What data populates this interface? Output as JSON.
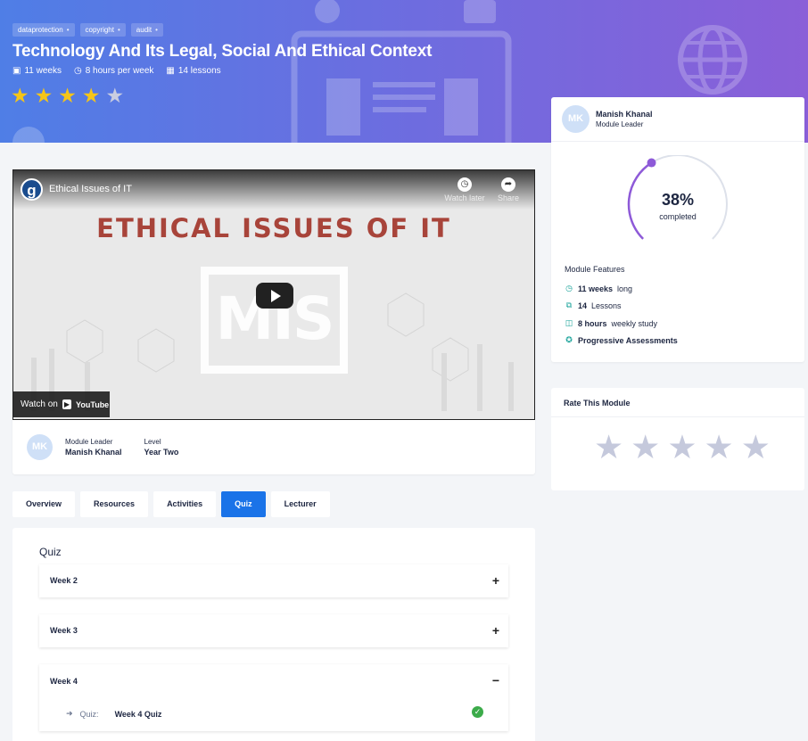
{
  "hero": {
    "tags": [
      "dataprotection",
      "copyright",
      "audit"
    ],
    "title": "Technology And Its Legal, Social And Ethical Context",
    "meta": {
      "weeks": "11 weeks",
      "hours": "8 hours per week",
      "lessons": "14 lessons"
    },
    "rating": {
      "value": 4,
      "max": 5
    }
  },
  "video": {
    "channel_initial": "g",
    "title": "Ethical Issues of IT",
    "watch_later": "Watch later",
    "share": "Share",
    "banner": "ETHICAL ISSUES OF IT",
    "logo_text": "MIS",
    "watch_on": "Watch on",
    "youtube": "YouTube"
  },
  "leader_row": {
    "initials": "MK",
    "leader_label": "Module Leader",
    "leader_name": "Manish Khanal",
    "level_label": "Level",
    "level_value": "Year Two"
  },
  "tabs": [
    {
      "label": "Overview",
      "active": false
    },
    {
      "label": "Resources",
      "active": false
    },
    {
      "label": "Activities",
      "active": false
    },
    {
      "label": "Quiz",
      "active": true
    },
    {
      "label": "Lecturer",
      "active": false
    }
  ],
  "quiz": {
    "heading": "Quiz",
    "weeks": [
      {
        "label": "Week 2",
        "open": false
      },
      {
        "label": "Week 3",
        "open": false
      },
      {
        "label": "Week 4",
        "open": true
      }
    ],
    "item": {
      "kind": "Quiz:",
      "name": "Week 4 Quiz",
      "done": true
    }
  },
  "sidebar": {
    "initials": "MK",
    "name": "Manish Khanal",
    "role": "Module Leader",
    "progress": {
      "percent": 38,
      "percent_label": "38%",
      "caption": "completed"
    },
    "features_title": "Module Features",
    "features": [
      {
        "bold": "11 weeks",
        "rest": "long",
        "icon": "clock-icon"
      },
      {
        "bold": "14",
        "rest": "Lessons",
        "icon": "copy-icon"
      },
      {
        "bold": "8 hours",
        "rest": "weekly study",
        "icon": "book-icon"
      },
      {
        "bold": "Progressive Assessments",
        "rest": "",
        "icon": "award-icon"
      }
    ],
    "rate_title": "Rate This Module",
    "rate_stars": 5
  },
  "colors": {
    "accent": "#1a73e8",
    "star": "#f5c518",
    "progress": "#8e5ad8",
    "feature_icon": "#1aa39a"
  }
}
